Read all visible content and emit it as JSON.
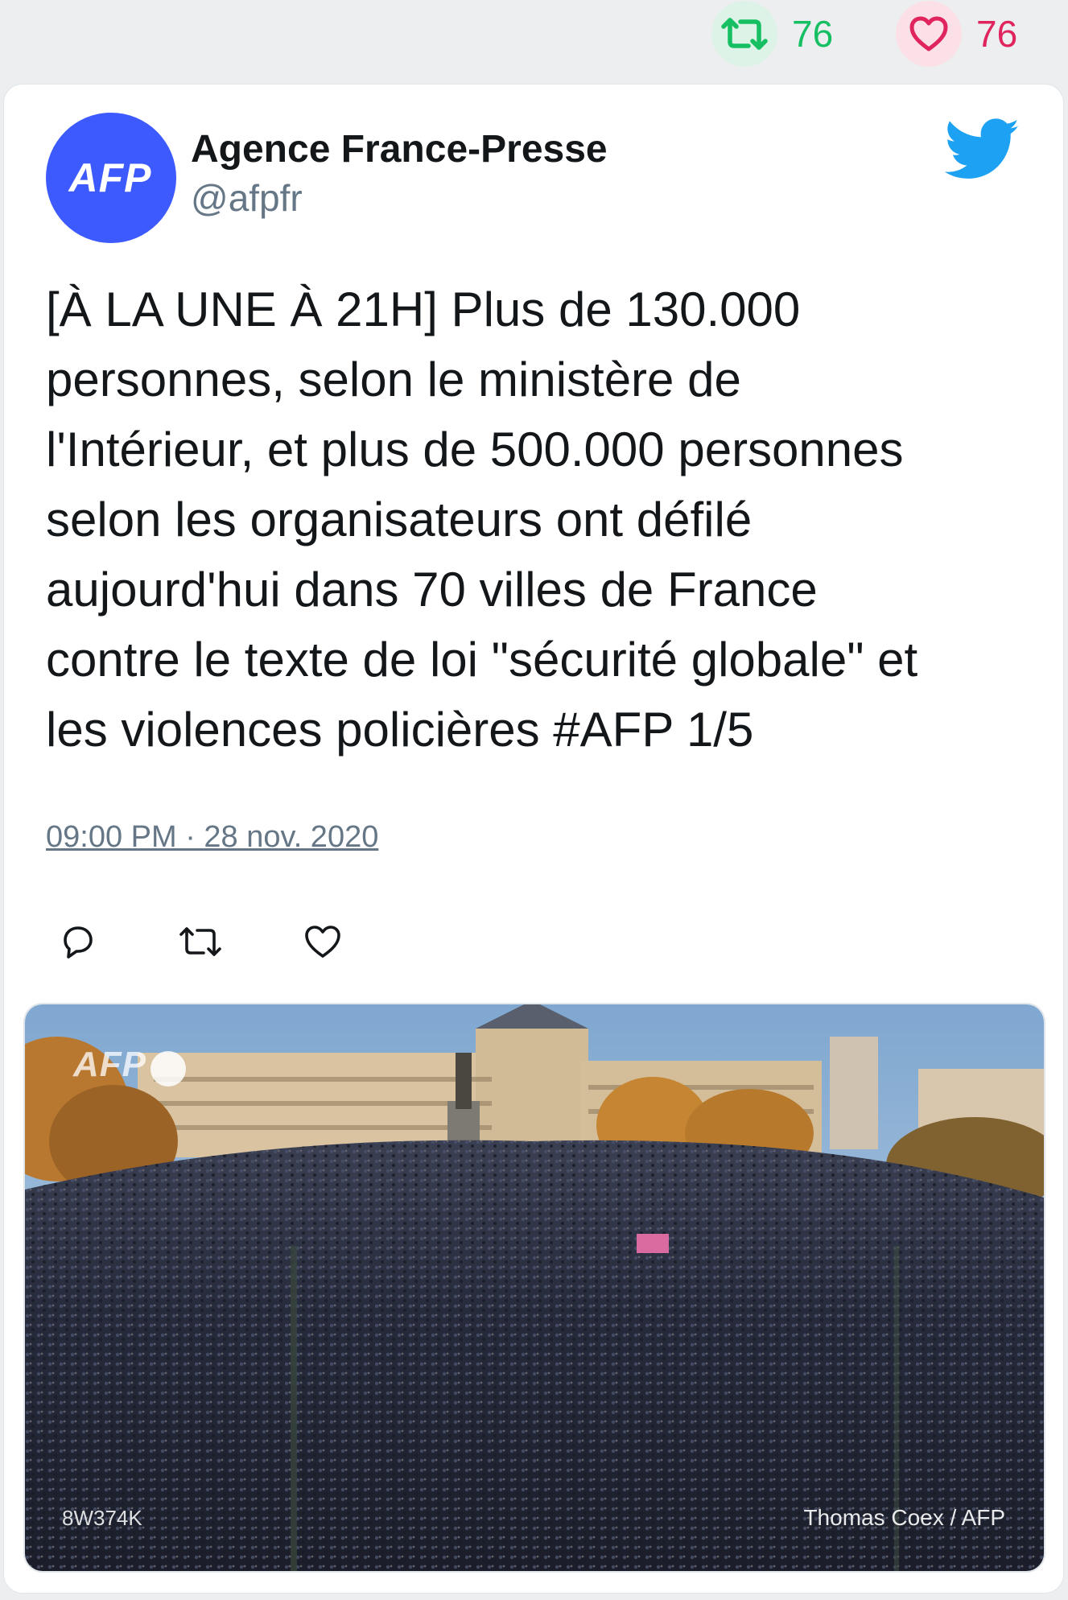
{
  "stats": {
    "retweet_count": "76",
    "like_count": "76",
    "retweet_icon": "retweet-icon",
    "like_icon": "heart-icon"
  },
  "author": {
    "name": "Agence France-Presse",
    "handle": "@afpfr",
    "avatar_text": "AFP",
    "avatar_color": "#3d5afe"
  },
  "tweet": {
    "text": "[À LA UNE À 21H] Plus de 130.000\npersonnes, selon le ministère de\nl'Intérieur, et plus de 500.000 personnes\nselon les organisateurs ont défilé\naujourd'hui dans 70 villes de France\ncontre le texte de loi \"sécurité globale\" et\nles violences policières #AFP 1/5",
    "timestamp": "09:00 PM · 28 nov. 2020"
  },
  "actions": {
    "reply_icon": "reply-icon",
    "retweet_icon": "retweet-icon",
    "like_icon": "heart-icon"
  },
  "media": {
    "watermark": "AFP",
    "code": "8W374K",
    "credit": "Thomas Coex / AFP"
  },
  "brand": {
    "twitter_blue": "#1da1f2",
    "retweet_green": "#17bf63",
    "like_red": "#e0245e"
  }
}
